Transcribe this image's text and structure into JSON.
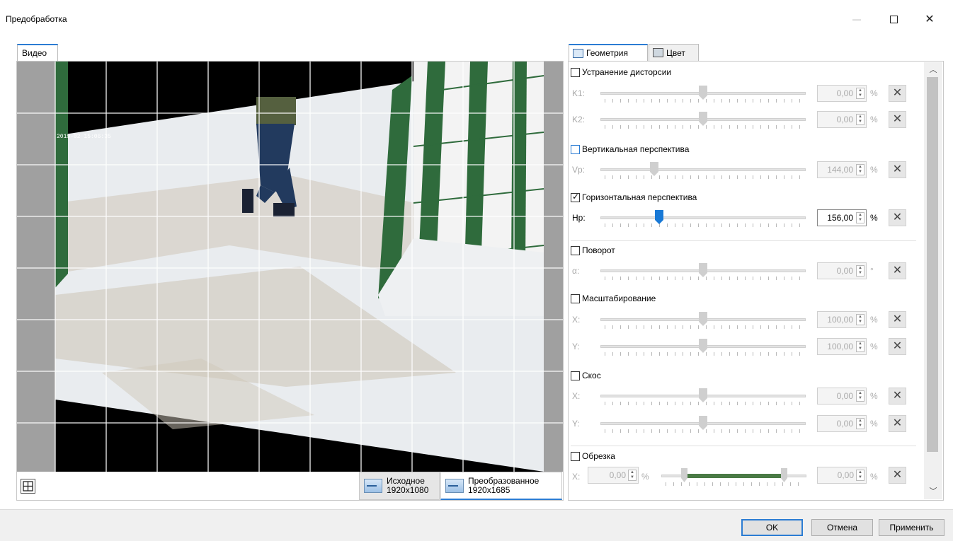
{
  "window": {
    "title": "Предобработка",
    "controls": {
      "minimize": "—",
      "maximize": "",
      "close": "✕"
    }
  },
  "left": {
    "tab_label": "Видео",
    "view_tabs": [
      {
        "title": "Исходное",
        "size": "1920x1080",
        "selected": false
      },
      {
        "title": "Преобразованное",
        "size": "1920x1685",
        "selected": true
      }
    ],
    "grid_toggle_icon": "grid-icon",
    "overlay_timestamp": "2019-02 15:06:35"
  },
  "right": {
    "tabs": [
      {
        "label": "Геометрия",
        "icon": "geometry-icon",
        "selected": true
      },
      {
        "label": "Цвет",
        "icon": "color-icon",
        "selected": false
      }
    ],
    "sections": {
      "distortion": {
        "label": "Устранение дисторсии",
        "checked": false,
        "rows": [
          {
            "label": "K1:",
            "value": "0,00",
            "unit": "%",
            "position": 0.5
          },
          {
            "label": "K2:",
            "value": "0,00",
            "unit": "%",
            "position": 0.5
          }
        ]
      },
      "vertical": {
        "label": "Вертикальная перспектива",
        "checked": false,
        "rows": [
          {
            "label": "Vp:",
            "value": "144,00",
            "unit": "%",
            "position": 0.26
          }
        ]
      },
      "horizontal": {
        "label": "Горизонтальная перспектива",
        "checked": true,
        "rows": [
          {
            "label": "Hp:",
            "value": "156,00",
            "unit": "%",
            "position": 0.28
          }
        ]
      },
      "rotation": {
        "label": "Поворот",
        "checked": false,
        "rows": [
          {
            "label": "α:",
            "value": "0,00",
            "unit": "°",
            "position": 0.5
          }
        ]
      },
      "scale": {
        "label": "Масштабирование",
        "checked": false,
        "rows": [
          {
            "label": "X:",
            "value": "100,00",
            "unit": "%",
            "position": 0.5
          },
          {
            "label": "Y:",
            "value": "100,00",
            "unit": "%",
            "position": 0.5
          }
        ]
      },
      "skew": {
        "label": "Скос",
        "checked": false,
        "rows": [
          {
            "label": "X:",
            "value": "0,00",
            "unit": "%",
            "position": 0.5
          },
          {
            "label": "Y:",
            "value": "0,00",
            "unit": "%",
            "position": 0.5
          }
        ]
      },
      "crop": {
        "label": "Обрезка",
        "checked": false,
        "x_label": "X:",
        "left_value": "0,00",
        "right_value": "0,00",
        "unit": "%"
      }
    },
    "reset_symbol": "✕"
  },
  "buttons": {
    "ok": "OK",
    "cancel": "Отмена",
    "apply": "Применить"
  },
  "colors": {
    "accent": "#2b7cd3",
    "crop_range": "#4a7a45",
    "frame_border": "#000000",
    "gate": "#2f6b3c"
  }
}
